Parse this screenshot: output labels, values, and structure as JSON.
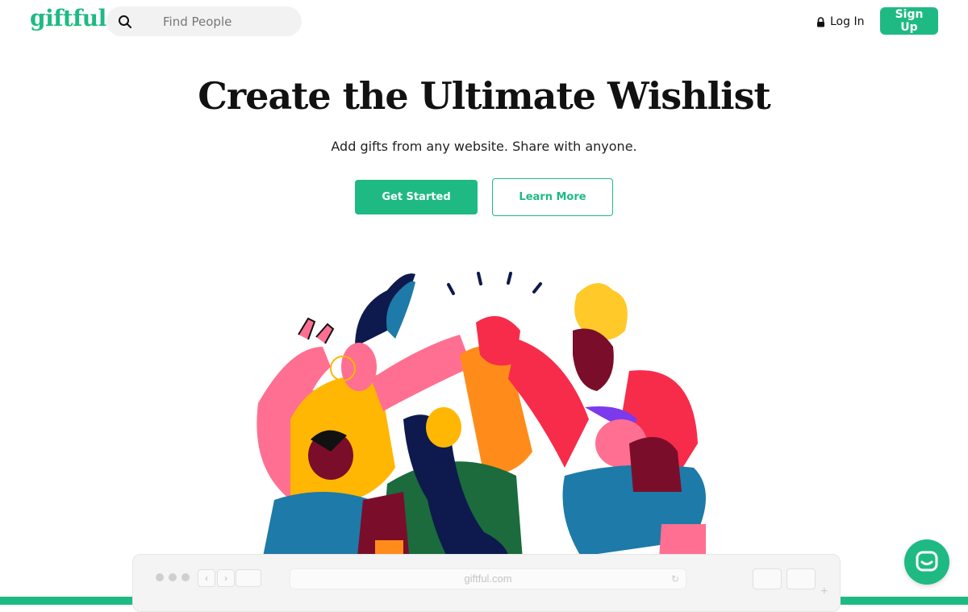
{
  "header": {
    "logo": "giftful",
    "search": {
      "placeholder": "Find People",
      "icon": "search-icon"
    },
    "login_label": "Log In",
    "signup_label": "Sign Up"
  },
  "hero": {
    "title": "Create the Ultimate Wishlist",
    "subtitle": "Add gifts from any website. Share with anyone.",
    "primary_cta": "Get Started",
    "secondary_cta": "Learn More"
  },
  "browser_mockup": {
    "url": "giftful.com"
  },
  "chat": {
    "icon": "chat-bubble-icon"
  },
  "colors": {
    "brand": "#1fba83",
    "text": "#111111",
    "search_bg": "#f2f2f2"
  }
}
